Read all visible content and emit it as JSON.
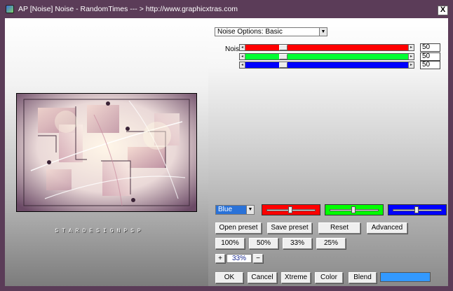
{
  "window": {
    "title": "AP [Noise]  Noise - RandomTimes    --- > http://www.graphicxtras.com",
    "close_label": "X"
  },
  "preview": {
    "credit": "STARDESIGNPSP"
  },
  "noise_options": {
    "selected": "Noise Options: Basic"
  },
  "noise": {
    "label": "Noise:",
    "sliders": [
      {
        "channel": "red",
        "color": "#ff0000",
        "value": "50"
      },
      {
        "channel": "green",
        "color": "#00ff33",
        "value": "50"
      },
      {
        "channel": "blue",
        "color": "#0000ff",
        "value": "50"
      }
    ]
  },
  "channel_select": {
    "selected": "Blue",
    "panel_colors": [
      "#ff0000",
      "#00ff00",
      "#0000ff"
    ]
  },
  "preset_buttons": [
    "Open preset",
    "Save preset",
    "Reset",
    "Advanced"
  ],
  "zoom_buttons": [
    "100%",
    "50%",
    "33%",
    "25%"
  ],
  "zoom": {
    "plus": "+",
    "value": "33%",
    "minus": "−"
  },
  "action_buttons": [
    "OK",
    "Cancel",
    "Xtreme",
    "Color",
    "Blend"
  ],
  "colors": {
    "title_bar": "#5b3c58",
    "accent_swatch": "#3399ff"
  }
}
